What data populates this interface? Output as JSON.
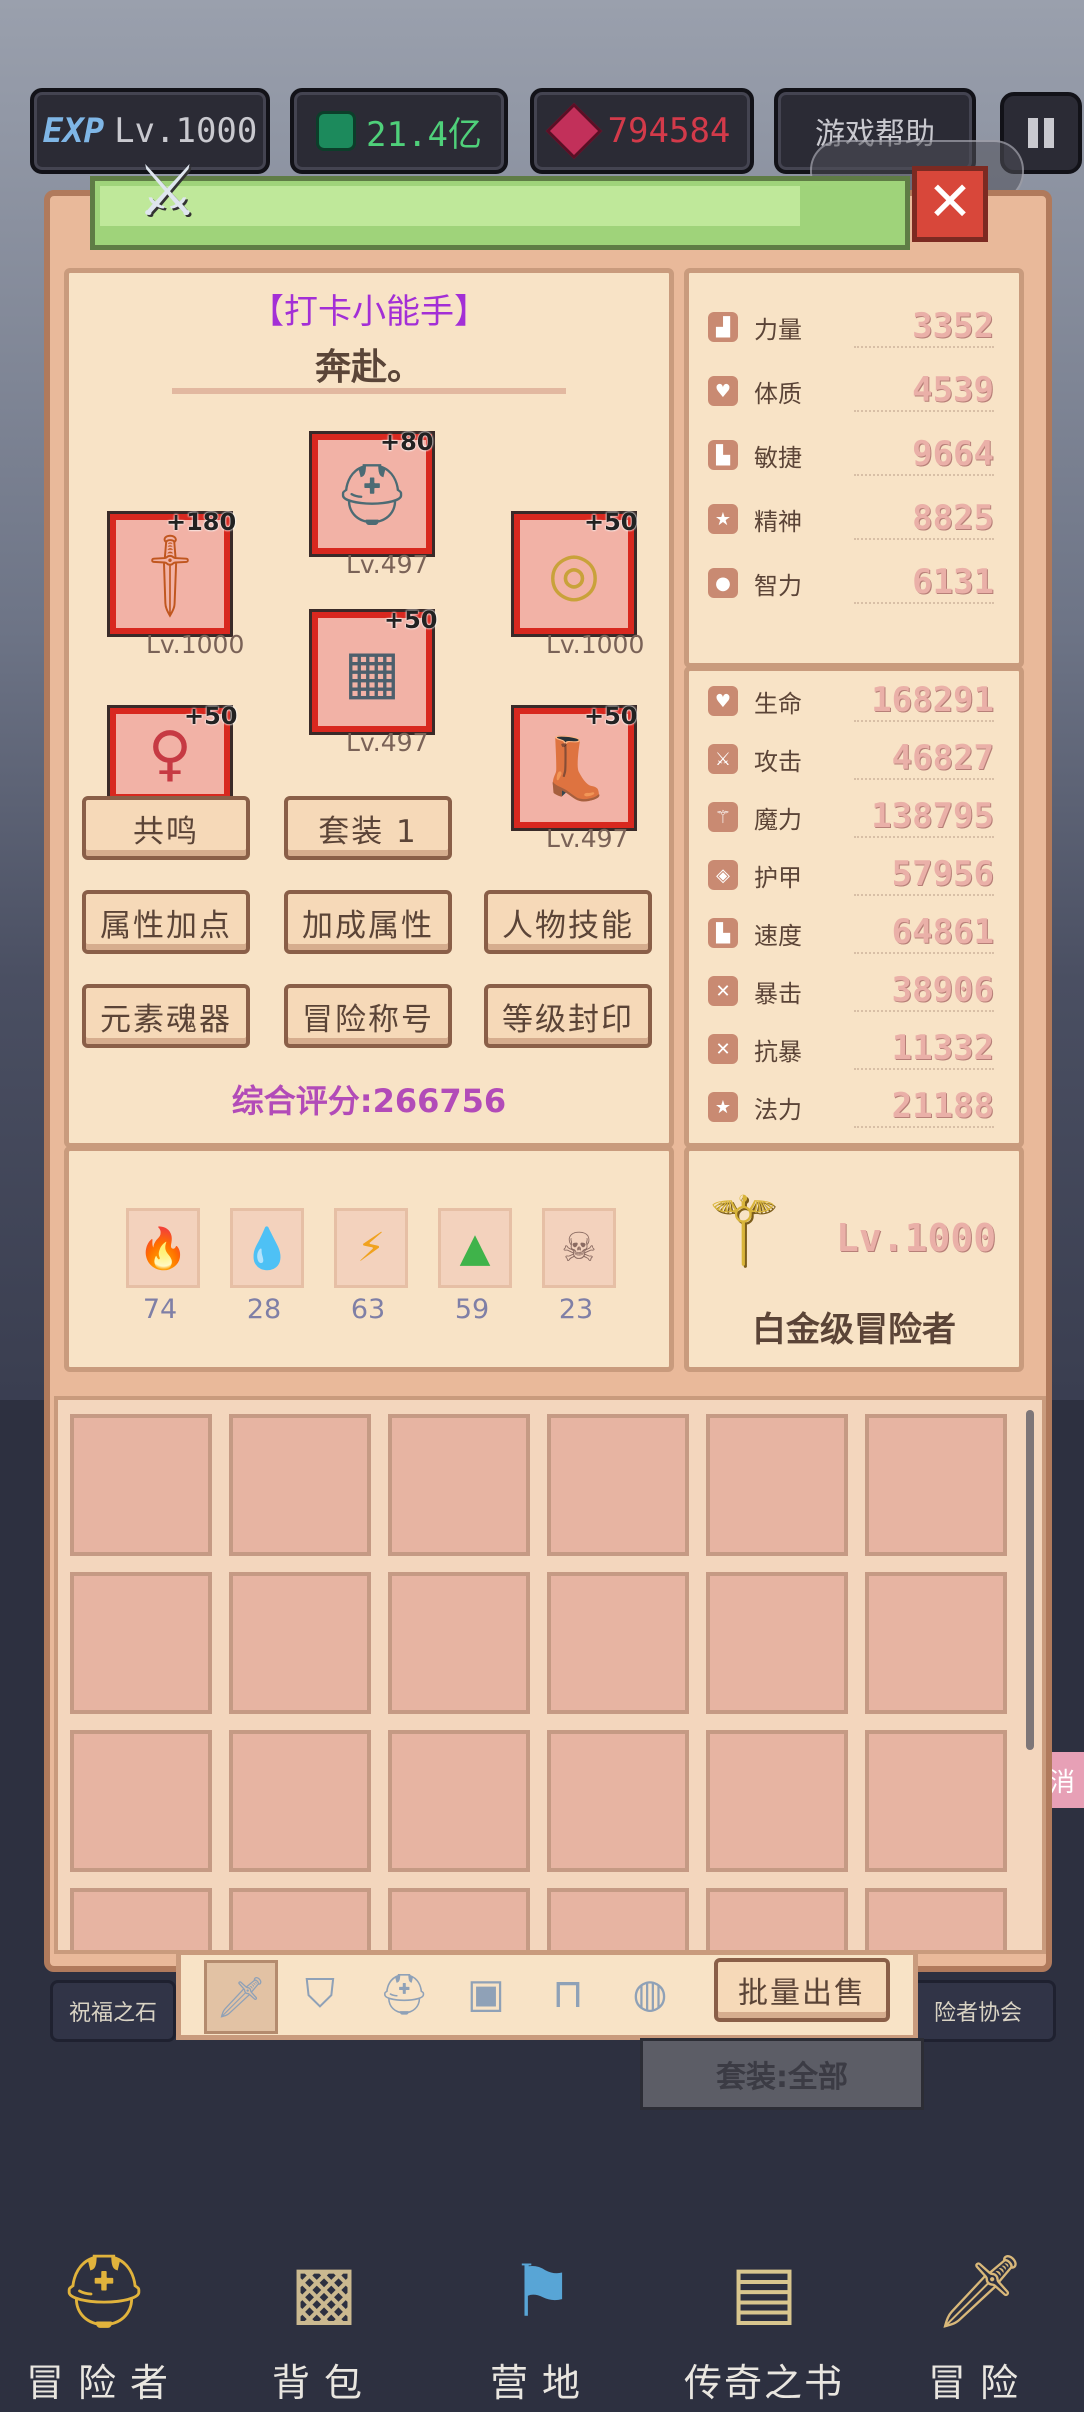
{
  "top_bar": {
    "exp_label": "EXP",
    "level": "Lv.1000",
    "currency_green": "21.4亿",
    "currency_red": "794584",
    "help_button": "游戏帮助"
  },
  "character": {
    "title": "【打卡小能手】",
    "name": "奔赴。",
    "equipment": [
      {
        "slot": "helmet",
        "plus": "+80",
        "level": "Lv.497",
        "icon": "horned-helmet-icon"
      },
      {
        "slot": "weapon",
        "plus": "+180",
        "level": "Lv.1000",
        "icon": "sword-icon"
      },
      {
        "slot": "shield",
        "plus": "+50",
        "level": "Lv.1000",
        "icon": "round-shield-icon"
      },
      {
        "slot": "armor",
        "plus": "+50",
        "level": "Lv.497",
        "icon": "chest-armor-icon"
      },
      {
        "slot": "amulet",
        "plus": "+50",
        "level": "",
        "icon": "amulet-icon"
      },
      {
        "slot": "boots",
        "plus": "+50",
        "level": "Lv.497",
        "icon": "boots-icon"
      }
    ],
    "buttons": [
      "共鸣",
      "套装 1",
      "属性加点",
      "加成属性",
      "人物技能",
      "元素魂器",
      "冒险称号",
      "等级封印"
    ],
    "score_label": "综合评分:266756"
  },
  "base_stats": [
    {
      "name": "力量",
      "value": "3352",
      "icon": "strength-icon"
    },
    {
      "name": "体质",
      "value": "4539",
      "icon": "heart-icon"
    },
    {
      "name": "敏捷",
      "value": "9664",
      "icon": "boot-icon"
    },
    {
      "name": "精神",
      "value": "8825",
      "icon": "star-icon"
    },
    {
      "name": "智力",
      "value": "6131",
      "icon": "brain-icon"
    }
  ],
  "combat_stats": [
    {
      "name": "生命",
      "value": "168291",
      "icon": "heart-icon"
    },
    {
      "name": "攻击",
      "value": "46827",
      "icon": "sword-icon"
    },
    {
      "name": "魔力",
      "value": "138795",
      "icon": "wand-icon"
    },
    {
      "name": "护甲",
      "value": "57956",
      "icon": "shield-icon"
    },
    {
      "name": "速度",
      "value": "64861",
      "icon": "boot-icon"
    },
    {
      "name": "暴击",
      "value": "38906",
      "icon": "crit-icon"
    },
    {
      "name": "抗暴",
      "value": "11332",
      "icon": "anti-crit-icon"
    },
    {
      "name": "法力",
      "value": "21188",
      "icon": "star-icon"
    }
  ],
  "elements": [
    {
      "icon": "fire-icon",
      "value": "74",
      "color": "#e8502a"
    },
    {
      "icon": "water-icon",
      "value": "28",
      "color": "#3b8be0"
    },
    {
      "icon": "lightning-icon",
      "value": "63",
      "color": "#f0a21f"
    },
    {
      "icon": "earth-icon",
      "value": "59",
      "color": "#3fb34a"
    },
    {
      "icon": "skull-icon",
      "value": "23",
      "color": "#8a6b62"
    }
  ],
  "rank": {
    "level": "Lv.1000",
    "title": "白金级冒险者"
  },
  "inventory": {
    "tabs": [
      "sword-icon",
      "shield-icon",
      "helmet-icon",
      "armor-icon",
      "bench-icon",
      "ring-icon"
    ],
    "sell_button": "批量出售",
    "filter_label": "套装:全部"
  },
  "side_fragments": {
    "left_button": "祝福之石",
    "right_button": "险者协会",
    "cancel": "消"
  },
  "bottom_nav": [
    {
      "label": "冒险者",
      "icon": "adventurer-helmet-icon"
    },
    {
      "label": "背包",
      "icon": "backpack-icon"
    },
    {
      "label": "营地",
      "icon": "camp-banner-icon"
    },
    {
      "label": "传奇之书",
      "icon": "legend-book-icon"
    },
    {
      "label": "冒险",
      "icon": "adventure-sword-icon"
    }
  ]
}
